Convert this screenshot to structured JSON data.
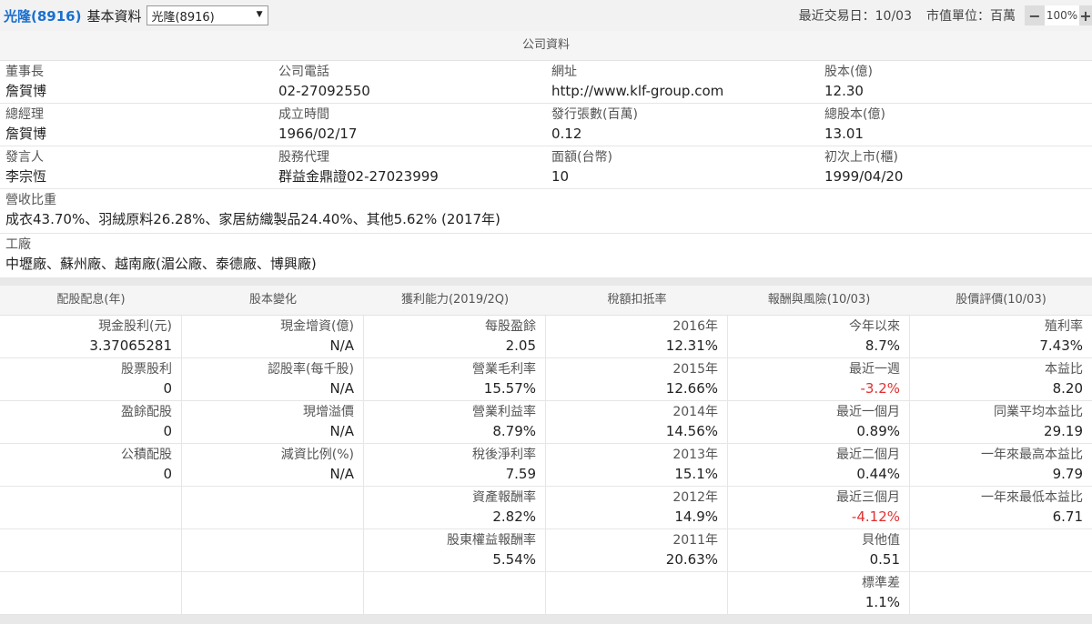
{
  "header": {
    "stock_name": "光隆(8916)",
    "page_title": "基本資料",
    "select_value": "光隆(8916)",
    "last_trade": "最近交易日：10/03",
    "market_unit": "市值單位：百萬",
    "zoom_minus": "−",
    "zoom_level": "100%",
    "zoom_plus": "+"
  },
  "company": {
    "section_title": "公司資料",
    "rows": [
      [
        {
          "label": "董事長",
          "value": "詹賀博"
        },
        {
          "label": "公司電話",
          "value": "02-27092550"
        },
        {
          "label": "網址",
          "value": "http://www.klf-group.com"
        },
        {
          "label": "股本(億)",
          "value": "12.30"
        }
      ],
      [
        {
          "label": "總經理",
          "value": "詹賀博"
        },
        {
          "label": "成立時間",
          "value": "1966/02/17"
        },
        {
          "label": "發行張數(百萬)",
          "value": "0.12"
        },
        {
          "label": "總股本(億)",
          "value": "13.01"
        }
      ],
      [
        {
          "label": "發言人",
          "value": "李宗恆"
        },
        {
          "label": "股務代理",
          "value": "群益金鼎證02-27023999"
        },
        {
          "label": "面額(台幣)",
          "value": "10"
        },
        {
          "label": "初次上市(櫃)",
          "value": "1999/04/20"
        }
      ]
    ],
    "revenue": {
      "label": "營收比重",
      "value": "成衣43.70%、羽絨原料26.28%、家居紡織製品24.40%、其他5.62% (2017年)"
    },
    "factory": {
      "label": "工廠",
      "value": "中壢廠、蘇州廠、越南廠(湄公廠、泰德廠、博興廠)"
    }
  },
  "financial": {
    "headers": [
      "配股配息(年)",
      "股本變化",
      "獲利能力(2019/2Q)",
      "稅額扣抵率",
      "報酬與風險(10/03)",
      "股價評價(10/03)"
    ],
    "rows": [
      [
        {
          "label": "現金股利(元)",
          "value": "3.37065281"
        },
        {
          "label": "現金增資(億)",
          "value": "N/A"
        },
        {
          "label": "每股盈餘",
          "value": "2.05"
        },
        {
          "label": "2016年",
          "value": "12.31%"
        },
        {
          "label": "今年以來",
          "value": "8.7%"
        },
        {
          "label": "殖利率",
          "value": "7.43%"
        }
      ],
      [
        {
          "label": "股票股利",
          "value": "0"
        },
        {
          "label": "認股率(每千股)",
          "value": "N/A"
        },
        {
          "label": "營業毛利率",
          "value": "15.57%"
        },
        {
          "label": "2015年",
          "value": "12.66%"
        },
        {
          "label": "最近一週",
          "value": "-3.2%",
          "neg": true
        },
        {
          "label": "本益比",
          "value": "8.20"
        }
      ],
      [
        {
          "label": "盈餘配股",
          "value": "0"
        },
        {
          "label": "現增溢價",
          "value": "N/A"
        },
        {
          "label": "營業利益率",
          "value": "8.79%"
        },
        {
          "label": "2014年",
          "value": "14.56%"
        },
        {
          "label": "最近一個月",
          "value": "0.89%"
        },
        {
          "label": "同業平均本益比",
          "value": "29.19"
        }
      ],
      [
        {
          "label": "公積配股",
          "value": "0"
        },
        {
          "label": "減資比例(%)",
          "value": "N/A"
        },
        {
          "label": "稅後淨利率",
          "value": "7.59"
        },
        {
          "label": "2013年",
          "value": "15.1%"
        },
        {
          "label": "最近二個月",
          "value": "0.44%"
        },
        {
          "label": "一年來最高本益比",
          "value": "9.79"
        }
      ],
      [
        null,
        null,
        {
          "label": "資產報酬率",
          "value": "2.82%"
        },
        {
          "label": "2012年",
          "value": "14.9%"
        },
        {
          "label": "最近三個月",
          "value": "-4.12%",
          "neg": true
        },
        {
          "label": "一年來最低本益比",
          "value": "6.71"
        }
      ],
      [
        null,
        null,
        {
          "label": "股東權益報酬率",
          "value": "5.54%"
        },
        {
          "label": "2011年",
          "value": "20.63%"
        },
        {
          "label": "貝他值",
          "value": "0.51"
        },
        null
      ],
      [
        null,
        null,
        null,
        null,
        {
          "label": "標準差",
          "value": "1.1%"
        },
        null
      ]
    ]
  }
}
